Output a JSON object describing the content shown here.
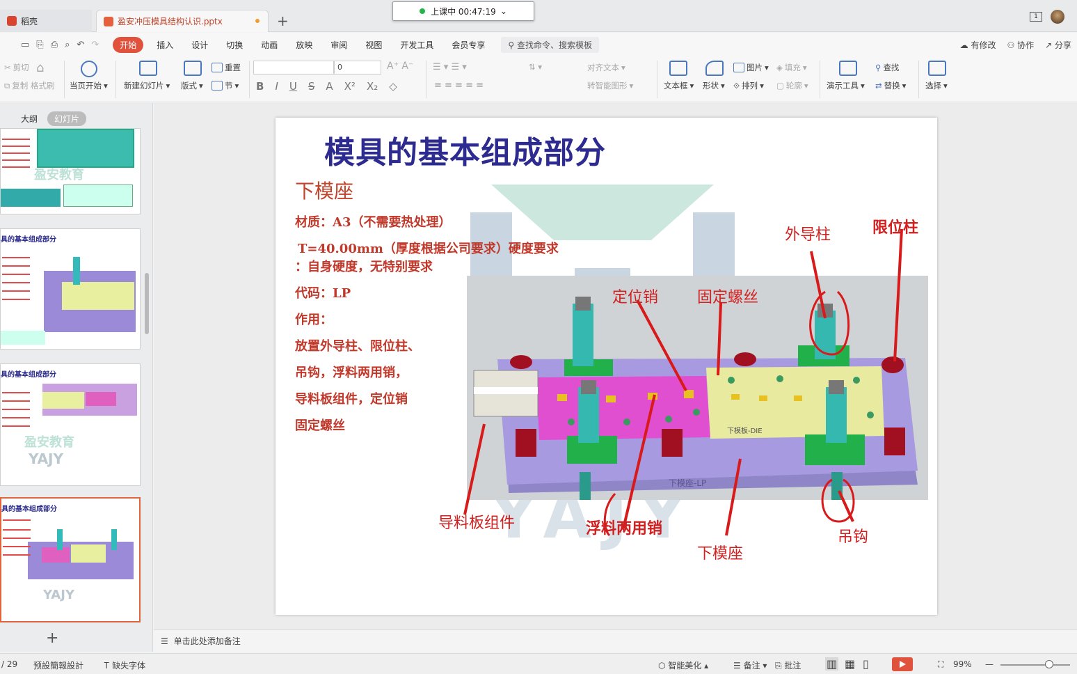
{
  "tabs": {
    "home": "稻壳",
    "doc": "盈安冲压模具结构认识.pptx",
    "timer": "上课中 00:47:19"
  },
  "topright": {
    "badge": "1"
  },
  "menu": {
    "items": [
      "开始",
      "插入",
      "设计",
      "切换",
      "动画",
      "放映",
      "审阅",
      "视图",
      "开发工具",
      "会员专享"
    ],
    "search": "查找命令、搜索模板",
    "right": [
      "有修改",
      "协作",
      "分享"
    ]
  },
  "ribbon": {
    "cut": "剪切",
    "copy": "复制",
    "format_painter": "格式刷",
    "play_from_current": "当页开始",
    "new_slide": "新建幻灯片",
    "layout": "版式",
    "reset": "重置",
    "section": "节",
    "font_size": "0",
    "align_text": "对齐文本",
    "smart_shape": "转智能图形",
    "textbox": "文本框",
    "shape": "形状",
    "picture": "图片",
    "fill": "填充",
    "arrange": "排列",
    "outline": "轮廓",
    "present_tool": "演示工具",
    "find": "查找",
    "replace": "替换",
    "select": "选择"
  },
  "panel": {
    "tab_outline": "大纲",
    "tab_slides": "幻灯片",
    "thumb_title": "具的基本组成部分",
    "thumb_wm": "盈安教育",
    "thumb_wm2": "YAJY"
  },
  "slide": {
    "title": "模具的基本组成部分",
    "subtitle": "下模座",
    "lines": [
      "材质：A3（不需要热处理）",
      "T=40.00mm（厚度根据公司要求）硬度要求",
      "：自身硬度，无特别要求",
      "代码：LP",
      "作用：",
      "放置外导柱、限位柱、",
      "吊钩，浮料两用销，",
      "导料板组件，定位销",
      "固定螺丝"
    ],
    "annotations": {
      "outer_guide": "外导柱",
      "stop_post": "限位柱",
      "locate_pin": "定位销",
      "fix_screw": "固定螺丝",
      "guide_plate": "导料板组件",
      "float_pin": "浮料两用销",
      "lower_base": "下模座",
      "hook": "吊钩"
    },
    "image_labels": {
      "die": "下模板-DIE",
      "lp": "下模座-LP"
    },
    "watermark": "YAJY"
  },
  "notes": {
    "placeholder": "单击此处添加备注"
  },
  "status": {
    "page": "/ 29",
    "design": "预設簡報設計",
    "missing_font": "缺失字体",
    "beautify": "智能美化",
    "notes": "备注",
    "comment": "批注",
    "zoom": "99%"
  },
  "colors": {
    "accent": "#e1523d",
    "title": "#2d2b8f",
    "red_text": "#c0392b"
  }
}
